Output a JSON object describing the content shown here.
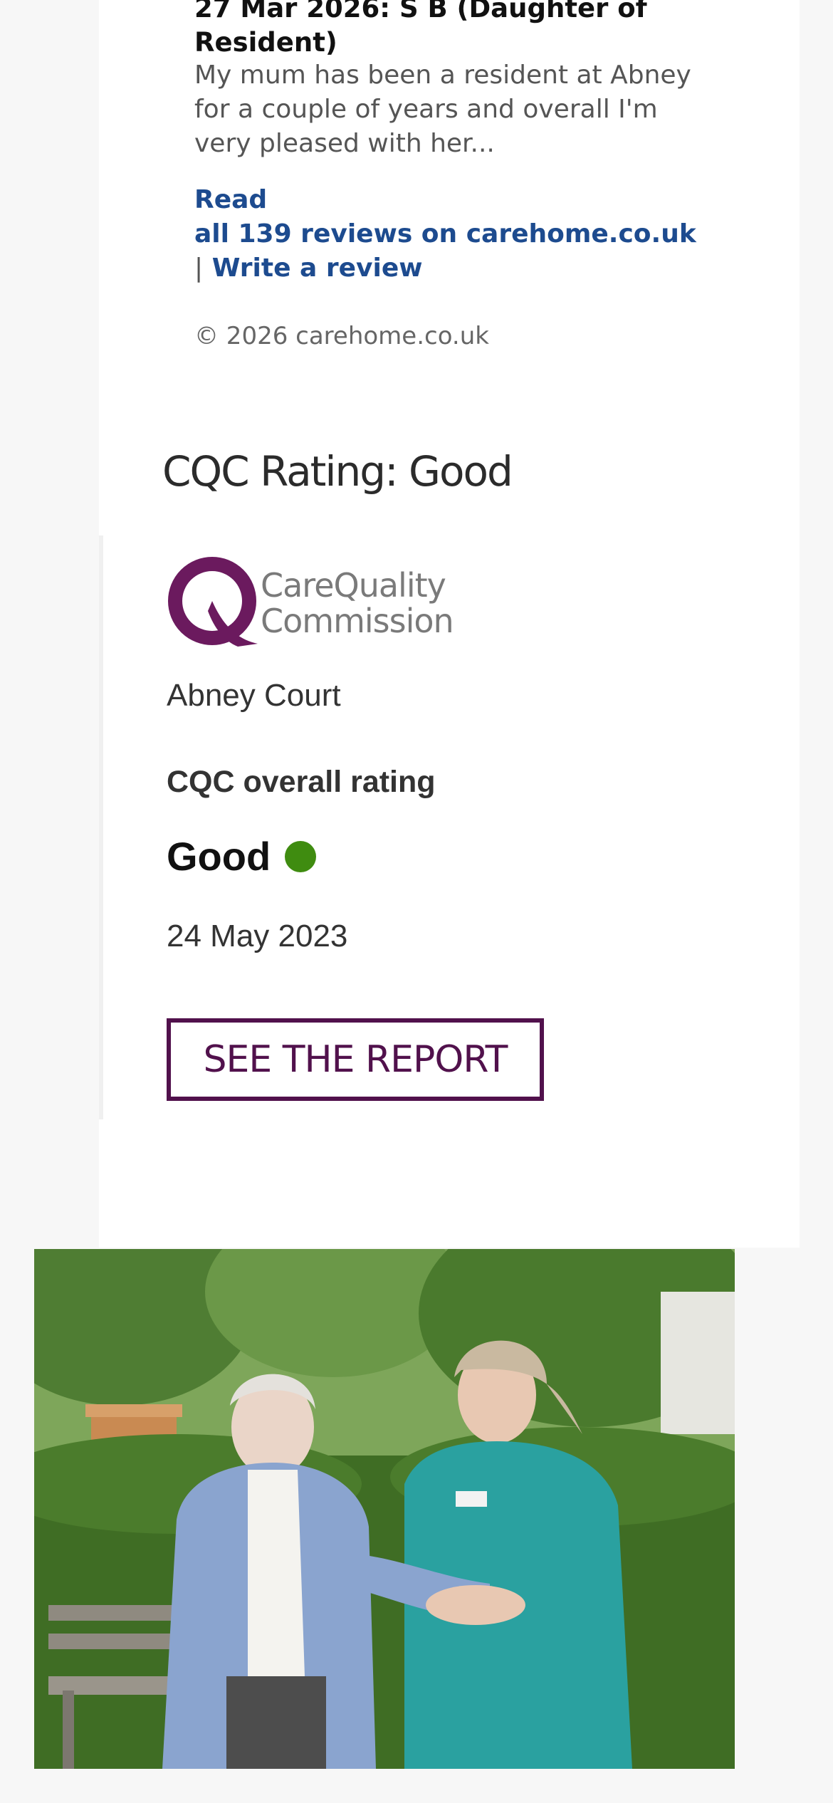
{
  "review": {
    "title": "27 Mar 2026: S B (Daughter of Resident)",
    "excerpt": "My mum has been a resident at Abney for a couple of years and overall I'm very pleased with her...",
    "read_label": "Read",
    "read_all_label": "all 139 reviews on carehome.co.uk",
    "separator": "|",
    "write_label": "Write a review",
    "copyright": "© 2026 carehome.co.uk"
  },
  "cqc": {
    "heading": "CQC Rating: Good",
    "logo_text_line1": "CareQuality",
    "logo_text_line2": "Commission",
    "location_name": "Abney Court",
    "overall_label": "CQC overall rating",
    "rating": "Good",
    "rating_color": "#3f8c10",
    "date": "24 May 2023",
    "report_button": "SEE THE REPORT",
    "brand_color": "#51114c"
  },
  "photo": {
    "icon": "photo-resident-and-carer"
  }
}
